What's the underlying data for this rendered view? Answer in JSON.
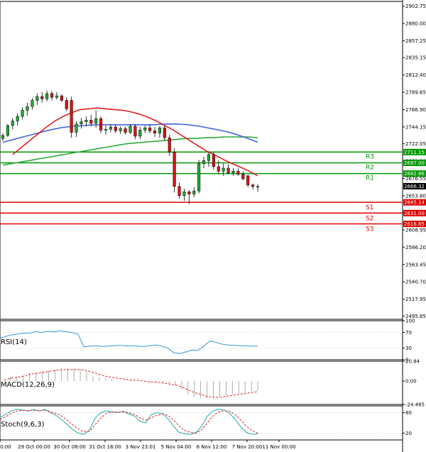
{
  "chart_data": {
    "type": "candlestick",
    "main": {
      "ylim": [
        2491.5,
        2909
      ],
      "yticks": [
        2902.75,
        2880.0,
        2857.25,
        2835.15,
        2812.4,
        2789.65,
        2766.9,
        2744.15,
        2722.05,
        2699.3,
        2676.55,
        2653.8,
        2631.7,
        2608.95,
        2586.2,
        2563.45,
        2540.7,
        2517.95,
        2495.85
      ],
      "ytick_labels": [
        "2902.75",
        "2880.00",
        "2857.25",
        "2835.15",
        "2812.40",
        "2789.65",
        "2766.90",
        "2744.15",
        "2722.05",
        "2699.30",
        "2676.55",
        "2653.80",
        "2631.70",
        "2608.95",
        "2586.20",
        "2563.45",
        "2540.70",
        "2517.95",
        "2495.85"
      ],
      "candles": [
        {
          "o": 2729,
          "h": 2736,
          "l": 2726,
          "c": 2733
        },
        {
          "o": 2733,
          "h": 2748,
          "l": 2731,
          "c": 2746
        },
        {
          "o": 2746,
          "h": 2756,
          "l": 2741,
          "c": 2752
        },
        {
          "o": 2752,
          "h": 2762,
          "l": 2746,
          "c": 2758
        },
        {
          "o": 2758,
          "h": 2770,
          "l": 2754,
          "c": 2766
        },
        {
          "o": 2766,
          "h": 2776,
          "l": 2759,
          "c": 2771
        },
        {
          "o": 2771,
          "h": 2782,
          "l": 2767,
          "c": 2779
        },
        {
          "o": 2779,
          "h": 2788,
          "l": 2773,
          "c": 2784
        },
        {
          "o": 2784,
          "h": 2790,
          "l": 2776,
          "c": 2781
        },
        {
          "o": 2781,
          "h": 2792,
          "l": 2778,
          "c": 2788
        },
        {
          "o": 2788,
          "h": 2791,
          "l": 2779,
          "c": 2783
        },
        {
          "o": 2783,
          "h": 2790,
          "l": 2780,
          "c": 2785
        },
        {
          "o": 2785,
          "h": 2787,
          "l": 2777,
          "c": 2779
        },
        {
          "o": 2779,
          "h": 2783,
          "l": 2765,
          "c": 2768
        },
        {
          "o": 2779,
          "h": 2784,
          "l": 2730,
          "c": 2737
        },
        {
          "o": 2737,
          "h": 2752,
          "l": 2731,
          "c": 2748
        },
        {
          "o": 2748,
          "h": 2756,
          "l": 2742,
          "c": 2751
        },
        {
          "o": 2751,
          "h": 2758,
          "l": 2745,
          "c": 2753
        },
        {
          "o": 2753,
          "h": 2760,
          "l": 2745,
          "c": 2749
        },
        {
          "o": 2749,
          "h": 2766,
          "l": 2743,
          "c": 2755
        },
        {
          "o": 2755,
          "h": 2758,
          "l": 2736,
          "c": 2740
        },
        {
          "o": 2740,
          "h": 2746,
          "l": 2734,
          "c": 2741
        },
        {
          "o": 2741,
          "h": 2748,
          "l": 2737,
          "c": 2744
        },
        {
          "o": 2744,
          "h": 2747,
          "l": 2736,
          "c": 2739
        },
        {
          "o": 2739,
          "h": 2745,
          "l": 2735,
          "c": 2742
        },
        {
          "o": 2742,
          "h": 2744,
          "l": 2734,
          "c": 2737
        },
        {
          "o": 2737,
          "h": 2748,
          "l": 2735,
          "c": 2745
        },
        {
          "o": 2745,
          "h": 2747,
          "l": 2728,
          "c": 2732
        },
        {
          "o": 2732,
          "h": 2744,
          "l": 2728,
          "c": 2740
        },
        {
          "o": 2740,
          "h": 2746,
          "l": 2736,
          "c": 2743
        },
        {
          "o": 2743,
          "h": 2748,
          "l": 2736,
          "c": 2739
        },
        {
          "o": 2739,
          "h": 2744,
          "l": 2731,
          "c": 2736
        },
        {
          "o": 2736,
          "h": 2745,
          "l": 2730,
          "c": 2743
        },
        {
          "o": 2743,
          "h": 2746,
          "l": 2726,
          "c": 2730
        },
        {
          "o": 2730,
          "h": 2734,
          "l": 2706,
          "c": 2711
        },
        {
          "o": 2711,
          "h": 2716,
          "l": 2658,
          "c": 2666
        },
        {
          "o": 2666,
          "h": 2671,
          "l": 2650,
          "c": 2654
        },
        {
          "o": 2654,
          "h": 2663,
          "l": 2647,
          "c": 2659
        },
        {
          "o": 2659,
          "h": 2661,
          "l": 2643,
          "c": 2656
        },
        {
          "o": 2656,
          "h": 2665,
          "l": 2652,
          "c": 2660
        },
        {
          "o": 2660,
          "h": 2701,
          "l": 2657,
          "c": 2696
        },
        {
          "o": 2696,
          "h": 2705,
          "l": 2690,
          "c": 2700
        },
        {
          "o": 2700,
          "h": 2712,
          "l": 2692,
          "c": 2708
        },
        {
          "o": 2708,
          "h": 2711,
          "l": 2688,
          "c": 2692
        },
        {
          "o": 2692,
          "h": 2700,
          "l": 2682,
          "c": 2686
        },
        {
          "o": 2686,
          "h": 2696,
          "l": 2680,
          "c": 2690
        },
        {
          "o": 2690,
          "h": 2695,
          "l": 2682,
          "c": 2684
        },
        {
          "o": 2684,
          "h": 2690,
          "l": 2680,
          "c": 2686
        },
        {
          "o": 2686,
          "h": 2690,
          "l": 2680,
          "c": 2682
        },
        {
          "o": 2682,
          "h": 2686,
          "l": 2674,
          "c": 2676
        },
        {
          "o": 2680,
          "h": 2681,
          "l": 2665,
          "c": 2668
        },
        {
          "o": 2668,
          "h": 2670,
          "l": 2662,
          "c": 2666
        },
        {
          "o": 2666,
          "h": 2669,
          "l": 2659,
          "c": 2666
        }
      ],
      "ma_red": [
        2708,
        2717,
        2726,
        2735,
        2744,
        2752,
        2758,
        2763,
        2767,
        2768,
        2769,
        2768,
        2767,
        2766,
        2764,
        2761,
        2757,
        2752,
        2746,
        2740,
        2733,
        2726,
        2719,
        2712,
        2707,
        2701,
        2696,
        2691,
        2686,
        2680
      ],
      "ma_blue": [
        2724,
        2728,
        2732,
        2736,
        2740,
        2743,
        2745,
        2746,
        2747,
        2747,
        2747,
        2747,
        2747,
        2747,
        2748,
        2748,
        2747,
        2745,
        2742,
        2739,
        2735,
        2730,
        2724
      ],
      "ma_green": [
        2694,
        2696,
        2698,
        2700,
        2702,
        2704,
        2706,
        2708,
        2710,
        2712,
        2714,
        2716,
        2718,
        2720,
        2722,
        2723,
        2724,
        2725,
        2726,
        2727,
        2728,
        2729,
        2729,
        2730,
        2730,
        2731,
        2731,
        2731,
        2731,
        2730
      ],
      "levels": [
        {
          "name": "R3",
          "value": 2711.15,
          "label": "2711.15",
          "color": "#009900"
        },
        {
          "name": "R2",
          "value": 2697.0,
          "label": "2697.00",
          "color": "#009900"
        },
        {
          "name": "R1",
          "value": 2682.86,
          "label": "2682.86",
          "color": "#009900"
        },
        {
          "name": "S1",
          "value": 2645.14,
          "label": "2645.14",
          "color": "#dd0000"
        },
        {
          "name": "S2",
          "value": 2631.0,
          "label": "2631.00",
          "color": "#dd0000"
        },
        {
          "name": "S3",
          "value": 2616.85,
          "label": "2616.85",
          "color": "#dd0000"
        }
      ],
      "last_price": "2666.32"
    },
    "rsi": {
      "name": "RSI(14)",
      "ylim": [
        0,
        100
      ],
      "yticks": [
        100,
        70,
        30,
        0
      ],
      "ytick_labels": [
        "100",
        "70",
        "30",
        "0"
      ],
      "values": [
        55,
        60,
        64,
        66,
        68,
        69,
        72,
        70,
        73,
        71,
        74,
        72,
        70,
        66,
        33,
        35,
        36,
        34,
        35,
        36,
        37,
        35,
        36,
        35,
        34,
        36,
        38,
        35,
        30,
        18,
        16,
        20,
        25,
        24,
        35,
        48,
        45,
        40,
        38,
        37,
        36,
        36,
        35,
        35
      ]
    },
    "macd": {
      "name": "MACD(12,26,9)",
      "ylim": [
        -24.465,
        20.84
      ],
      "yticks": [
        20.84,
        0.0,
        -24.465
      ],
      "ytick_labels": [
        "20.84",
        "0.00",
        "-24.465"
      ],
      "hist": [
        2,
        4,
        5,
        6,
        8,
        9,
        10,
        11,
        12,
        13,
        13,
        13,
        12,
        10,
        5,
        4,
        3,
        2,
        1,
        1,
        1,
        0,
        0,
        -1,
        -1,
        -2,
        -3,
        -5,
        -9,
        -14,
        -17,
        -18,
        -18,
        -17,
        -16,
        -15,
        -14,
        -13,
        -12,
        -11,
        -10
      ],
      "signal": [
        1,
        3,
        4,
        5,
        7,
        8,
        9,
        10,
        11,
        12,
        12,
        12,
        12,
        11,
        9,
        7,
        5,
        4,
        3,
        2,
        1,
        1,
        0,
        -1,
        -1,
        -2,
        -3,
        -4,
        -6,
        -9,
        -12,
        -14,
        -16,
        -17,
        -17,
        -16,
        -15,
        -14,
        -13,
        -12,
        -11
      ]
    },
    "stoch": {
      "name": "Stoch(9,6,3)",
      "ylim": [
        0,
        100
      ],
      "yticks": [
        80,
        20
      ],
      "ytick_labels": [
        "80",
        "20"
      ],
      "k": [
        65,
        75,
        85,
        90,
        88,
        85,
        89,
        85,
        90,
        80,
        72,
        60,
        45,
        30,
        20,
        16,
        30,
        65,
        80,
        85,
        82,
        80,
        84,
        76,
        70,
        55,
        50,
        75,
        80,
        78,
        62,
        40,
        22,
        18,
        16,
        22,
        40,
        70,
        85,
        90,
        88,
        78,
        60,
        38,
        22,
        16,
        18
      ],
      "d": [
        60,
        68,
        78,
        85,
        87,
        86,
        87,
        86,
        87,
        83,
        78,
        70,
        58,
        44,
        32,
        24,
        26,
        45,
        65,
        78,
        82,
        82,
        82,
        80,
        75,
        65,
        58,
        65,
        72,
        76,
        72,
        58,
        40,
        28,
        22,
        20,
        30,
        50,
        70,
        82,
        86,
        84,
        74,
        58,
        40,
        27,
        20
      ]
    },
    "xtick_labels": [
      "0:00",
      "29 Oct 00:00",
      "30 Oct 08:00",
      "31 Oct 16:00",
      "3 Nov 23:01",
      "5 Nov 04:00",
      "6 Nov 12:00",
      "7 Nov 20:00",
      "11 Nov 00:00"
    ]
  }
}
